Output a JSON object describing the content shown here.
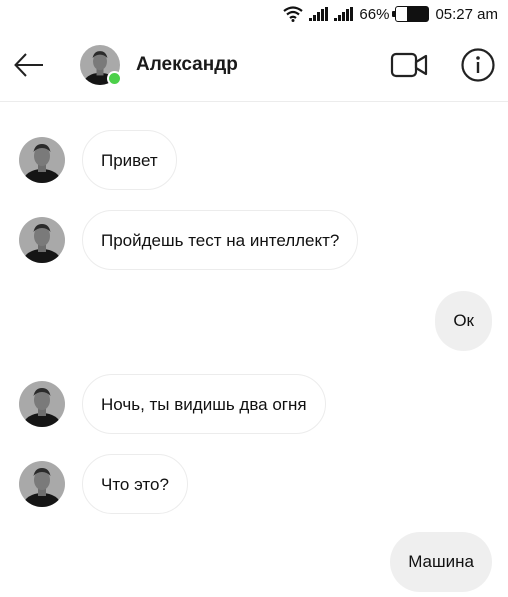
{
  "status_bar": {
    "battery_percent": "66%",
    "battery_level": 0.66,
    "time": "05:27 am",
    "icons": [
      "wifi-icon",
      "signal-icon",
      "signal-icon",
      "battery-icon"
    ]
  },
  "header": {
    "contact_name": "Александр",
    "online": true,
    "icons": [
      "back-arrow-icon",
      "video-call-icon",
      "info-icon"
    ]
  },
  "colors": {
    "online_dot": "#4cd04a",
    "incoming_bubble_border": "#ececec",
    "outgoing_bubble_bg": "#efefef"
  },
  "messages": [
    {
      "direction": "in",
      "text": "Привет"
    },
    {
      "direction": "in",
      "text": "Пройдешь тест на интеллект?"
    },
    {
      "direction": "out",
      "text": "Ок"
    },
    {
      "direction": "in",
      "text": "Ночь, ты видишь два огня"
    },
    {
      "direction": "in",
      "text": "Что это?"
    },
    {
      "direction": "out",
      "text": "Машина"
    }
  ]
}
